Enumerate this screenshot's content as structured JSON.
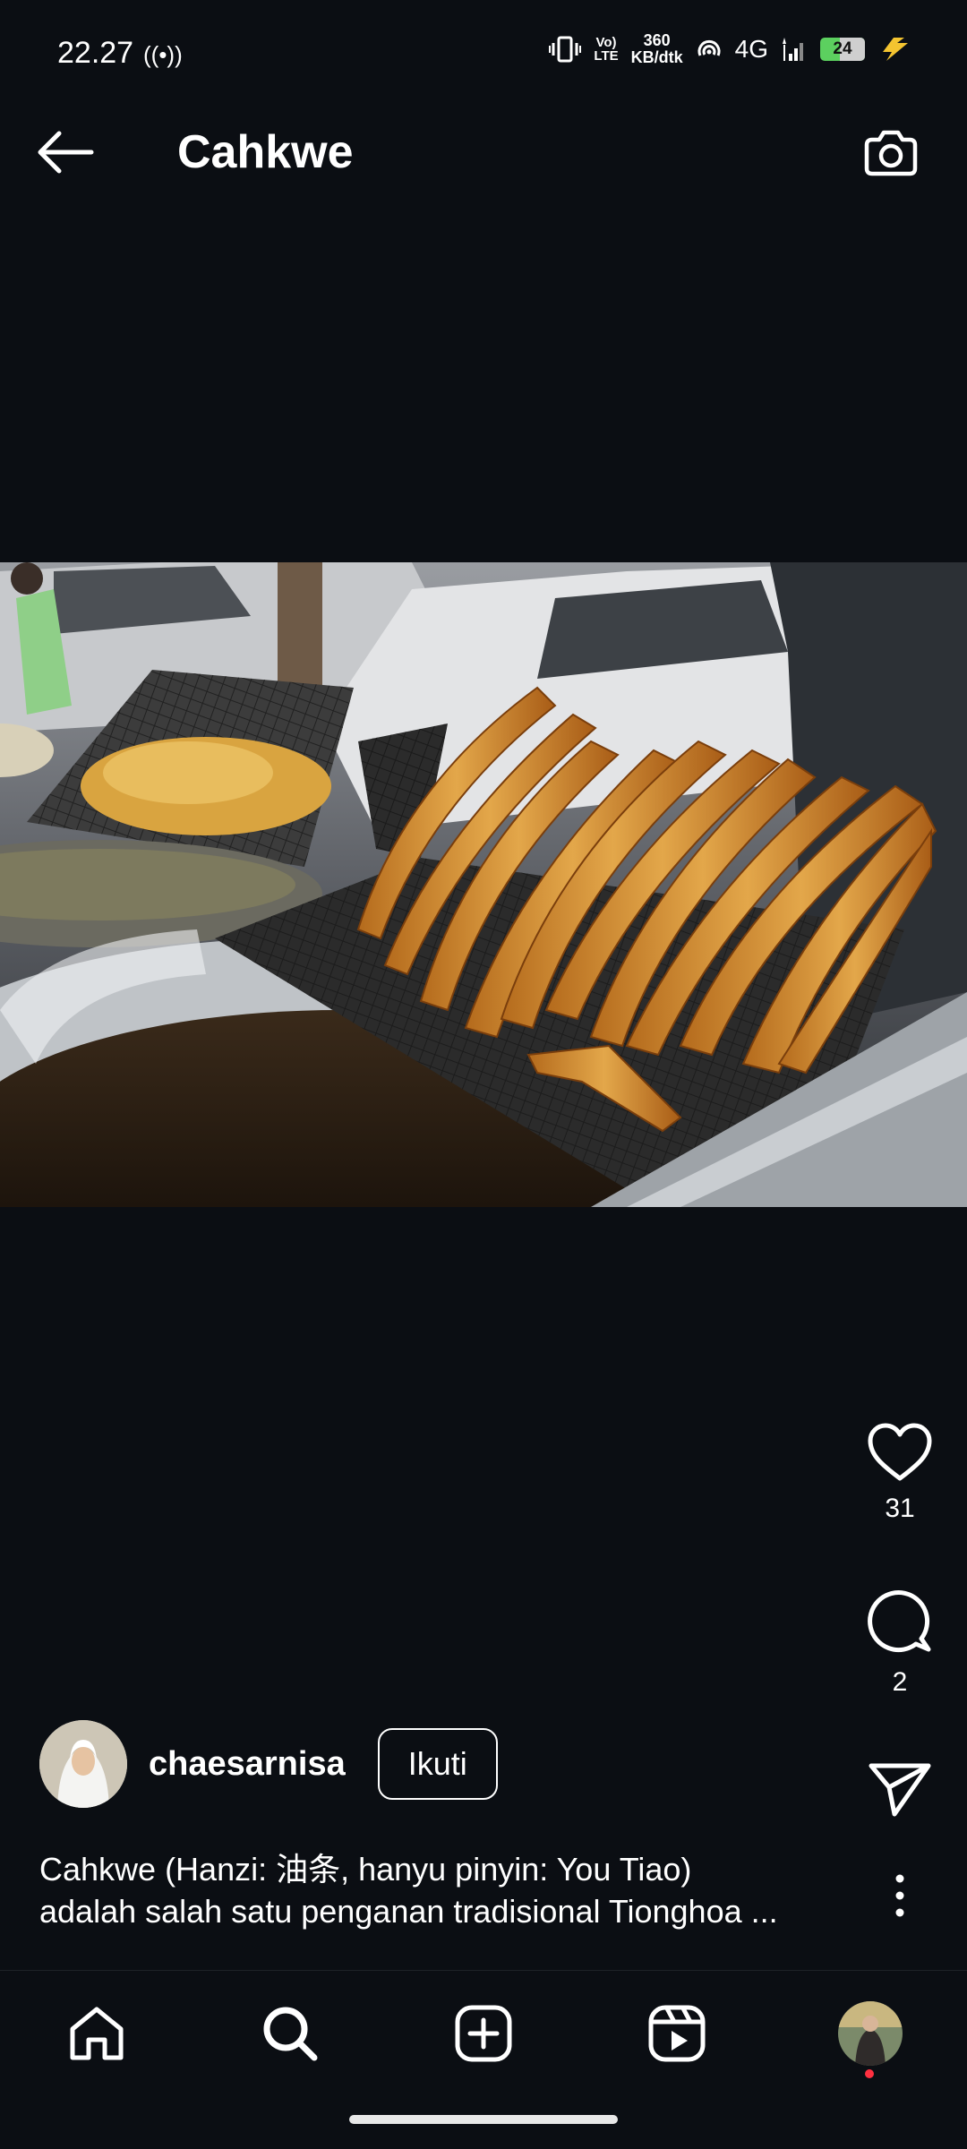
{
  "status_bar": {
    "time": "22.27",
    "hotspot_glyph": "((•))",
    "network_volte_top": "Vo)",
    "network_volte_bottom": "LTE",
    "speed_value": "360",
    "speed_unit": "KB/dtk",
    "network_type": "4G",
    "battery_level": "24"
  },
  "header": {
    "title": "Cahkwe"
  },
  "post": {
    "like_count": "31",
    "comment_count": "2",
    "username": "chaesarnisa",
    "follow_label": "Ikuti",
    "caption_line1": "Cahkwe (Hanzi: 油条, hanyu pinyin: You Tiao)",
    "caption_line2": "adalah salah satu penganan tradisional Tionghoa ..."
  },
  "icons": {
    "back": "arrow-left-icon",
    "camera": "camera-icon",
    "like": "heart-icon",
    "comment": "comment-icon",
    "share": "send-icon",
    "more": "more-vertical-icon",
    "home": "home-icon",
    "search": "search-icon",
    "create": "add-square-icon",
    "reels": "reels-icon",
    "profile": "profile-avatar"
  },
  "colors": {
    "background": "#0b0e13",
    "notification_dot": "#ff3040",
    "battery": "#5cd05f",
    "charging": "#f4c430"
  }
}
